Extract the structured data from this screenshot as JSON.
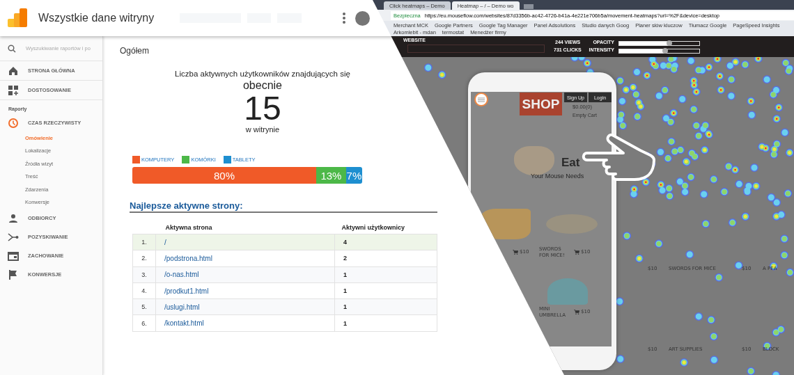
{
  "header": {
    "title": "Wszystkie dane witryny"
  },
  "sidebar": {
    "search_placeholder": "Wyszukiwanie raportów i po",
    "top_items": [
      {
        "label": "STRONA GŁÓWNA",
        "selected": false
      },
      {
        "label": "DOSTOSOWANIE",
        "selected": false
      }
    ],
    "section_label": "Raporty",
    "report_items": [
      {
        "label": "CZAS RZECZYWISTY",
        "selected": true,
        "expanded": true,
        "children": [
          {
            "label": "Omówienie",
            "selected": true
          },
          {
            "label": "Lokalizacje",
            "selected": false
          },
          {
            "label": "Źródła wizyt",
            "selected": false
          },
          {
            "label": "Treść",
            "selected": false
          },
          {
            "label": "Zdarzenia",
            "selected": false
          },
          {
            "label": "Konwersje",
            "selected": false
          }
        ]
      },
      {
        "label": "ODBIORCY",
        "selected": false
      },
      {
        "label": "POZYSKIWANIE",
        "selected": false
      },
      {
        "label": "ZACHOWANIE",
        "selected": false
      },
      {
        "label": "KONWERSJE",
        "selected": false
      }
    ]
  },
  "main": {
    "title": "Ogółem",
    "active_users": {
      "caption": "Liczba aktywnych użytkowników znajdujących się",
      "qualifier": "obecnie",
      "count": "15",
      "suffix": "w witrynie"
    },
    "legend": [
      {
        "label": "KOMPUTERY",
        "color": "#f05a28"
      },
      {
        "label": "KOMÓRKI",
        "color": "#4cb848"
      },
      {
        "label": "TABLETY",
        "color": "#1e8fd0"
      }
    ],
    "device_shares": [
      {
        "value": "80%",
        "color": "#f05a28"
      },
      {
        "value": "13%",
        "color": "#4cb848"
      },
      {
        "value": "7%",
        "color": "#1e8fd0"
      }
    ],
    "top_pages": {
      "title": "Najlepsze aktywne strony:",
      "columns": [
        "Aktywna strona",
        "Aktywni użytkownicy"
      ],
      "rows": [
        {
          "index": "1.",
          "page": "/",
          "users": "4",
          "selected": true
        },
        {
          "index": "2.",
          "page": "/podstrona.html",
          "users": "2",
          "selected": false
        },
        {
          "index": "3.",
          "page": "/o-nas.html",
          "users": "1",
          "selected": false
        },
        {
          "index": "4.",
          "page": "/prodkut1.html",
          "users": "1",
          "selected": false
        },
        {
          "index": "5.",
          "page": "/uslugi.html",
          "users": "1",
          "selected": false
        },
        {
          "index": "6.",
          "page": "/kontakt.html",
          "users": "1",
          "selected": false
        }
      ]
    }
  },
  "browser": {
    "tabs": [
      {
        "title": "Click heatmaps – Demo",
        "selected": false
      },
      {
        "title": "Heatmap – / – Demo wo",
        "selected": true
      }
    ],
    "secure_label": "Bezpieczna",
    "url": "https://eu.mouseflow.com/websites/87d3356b-ac42-4726-b41a-4e221e706b5a/movement-heatmaps?url=%2F&device=desktop",
    "bookmarks": [
      "Merchant MCK",
      "Google Partners",
      "Google Tag Manager",
      "Panel Adsolutions",
      "Studio danych Goog",
      "Planer słów kluczow",
      "Tłumacz Google",
      "PageSpeed Insights",
      "Arkomlebit - mdan",
      "termostat",
      "Menedżer firmy"
    ]
  },
  "heatmap": {
    "website_label": "WEBSITE",
    "views": "244 VIEWS",
    "clicks": "731 CLICKS",
    "sliders": [
      {
        "label": "OPACITY",
        "level": 0.63
      },
      {
        "label": "INTENSITY",
        "level": 0.57
      }
    ],
    "phone": {
      "logo": "SHOP",
      "buttons": [
        "Sign Up",
        "Login"
      ],
      "cart_total": "$0.00(0)",
      "cart_status": "Empty Cart",
      "hero_title": "Eat",
      "hero_subtitle": "Your Mouse Needs",
      "products": [
        {
          "price": "$10"
        },
        {
          "name": "SWORDS FOR MICE!",
          "price": "$10"
        },
        {
          "name": "MINI UMBRELLA",
          "price": "$10"
        }
      ]
    },
    "desktop_products": [
      {
        "price": "$10",
        "name": "SWORDS FOR MICE"
      },
      {
        "price": "$10",
        "name": "A PEA"
      },
      {
        "price": "$10",
        "name": "ART SUPPLIES"
      },
      {
        "price": "$10",
        "name": "BLOCK"
      }
    ]
  }
}
